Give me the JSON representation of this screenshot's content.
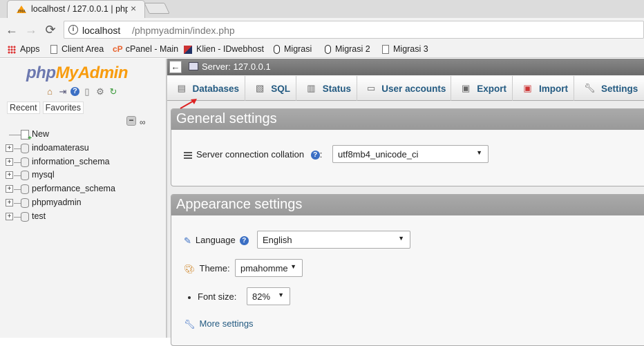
{
  "browser": {
    "tab_title": "localhost / 127.0.0.1 | php",
    "tab_close": "×",
    "url_host": "localhost",
    "url_path": "/phpmyadmin/index.php",
    "bookmarks": [
      {
        "label": "Apps"
      },
      {
        "label": "Client Area"
      },
      {
        "label": "cPanel - Main"
      },
      {
        "label": "Klien - IDwebhost"
      },
      {
        "label": "Migrasi"
      },
      {
        "label": "Migrasi 2"
      },
      {
        "label": "Migrasi 3"
      }
    ]
  },
  "sidebar": {
    "logo_php": "php",
    "logo_myadmin": "MyAdmin",
    "tabs": [
      "Recent",
      "Favorites"
    ],
    "tree": [
      {
        "label": "New"
      },
      {
        "label": "indoamaterasu"
      },
      {
        "label": "information_schema"
      },
      {
        "label": "mysql"
      },
      {
        "label": "performance_schema"
      },
      {
        "label": "phpmyadmin"
      },
      {
        "label": "test"
      }
    ]
  },
  "main": {
    "server_label": "Server: 127.0.0.1",
    "menu": [
      {
        "label": "Databases",
        "icon": "database-icon"
      },
      {
        "label": "SQL",
        "icon": "sql-icon"
      },
      {
        "label": "Status",
        "icon": "status-icon"
      },
      {
        "label": "User accounts",
        "icon": "users-icon"
      },
      {
        "label": "Export",
        "icon": "export-icon"
      },
      {
        "label": "Import",
        "icon": "import-icon"
      },
      {
        "label": "Settings",
        "icon": "wrench-icon"
      }
    ],
    "general": {
      "title": "General settings",
      "collation_label": "Server connection collation",
      "collation_colon": ":",
      "collation_value": "utf8mb4_unicode_ci"
    },
    "appearance": {
      "title": "Appearance settings",
      "language_label": "Language",
      "language_value": "English",
      "theme_label": "Theme:",
      "theme_value": "pmahomme",
      "fontsize_label": "Font size:",
      "fontsize_value": "82%",
      "more_settings": "More settings"
    }
  },
  "colors": {
    "accent": "#235a81",
    "logo_php": "#6c78af",
    "logo_myadmin": "#f89c0e",
    "legend_bg": "#999999",
    "arrow": "#dd2222"
  }
}
